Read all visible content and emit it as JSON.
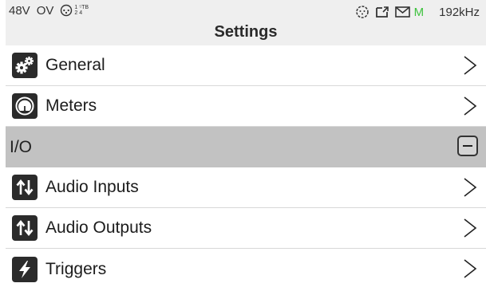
{
  "status": {
    "phantom_power": "48V",
    "overload": "OV",
    "io_map_top": "1 ⁵TB",
    "io_map_bottom": "2 4",
    "monitor": "M",
    "sample_rate": "192kHz"
  },
  "header": {
    "title": "Settings"
  },
  "menu": {
    "general": "General",
    "meters": "Meters",
    "io_section": "I/O",
    "audio_inputs": "Audio Inputs",
    "audio_outputs": "Audio Outputs",
    "triggers": "Triggers"
  },
  "colors": {
    "accent_monitor": "#3ec23e",
    "section_bg": "#c2c2c2",
    "icon_bg": "#2b2b2b"
  },
  "icons": {
    "general": "gears-icon",
    "meters": "gauge-icon",
    "audio_inputs": "up-down-arrows-icon",
    "audio_outputs": "up-down-arrows-icon",
    "triggers": "lightning-bolt-icon"
  }
}
